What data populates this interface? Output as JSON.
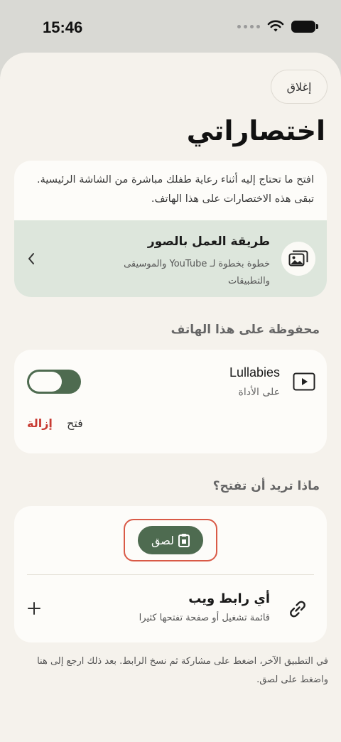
{
  "status_bar": {
    "time": "15:46"
  },
  "header": {
    "close_label": "إغلاق",
    "title": "اختصاراتي"
  },
  "intro": {
    "description": "افتح ما تحتاج إليه أثناء رعاية طفلك مباشرة من الشاشة الرئيسية. تبقى هذه الاختصارات على هذا الهاتف.",
    "featured": {
      "title": "طريقة العمل بالصور",
      "subtitle": "خطوة بخطوة لـ YouTube والموسيقى والتطبيقات"
    }
  },
  "saved": {
    "heading": "محفوظة على هذا الهاتف",
    "item": {
      "title": "Lullabies",
      "subtitle": "على الأداة",
      "toggle_on": true,
      "open_label": "فتح",
      "remove_label": "إزالة"
    }
  },
  "open_section": {
    "heading": "ماذا تريد أن تفتح؟",
    "paste_label": "لصق",
    "web_link": {
      "title": "أي رابط ويب",
      "subtitle": "قائمة تشغيل أو صفحة تفتحها كثيرا"
    }
  },
  "footer_note": "في التطبيق الآخر، اضغط على مشاركة ثم نسخ الرابط. بعد ذلك ارجع إلى هنا واضغط على لصق.",
  "colors": {
    "accent": "#4e6b50",
    "remove": "#c83a32",
    "highlight_frame": "#d95a47",
    "featured_bg": "#dde6dc"
  }
}
